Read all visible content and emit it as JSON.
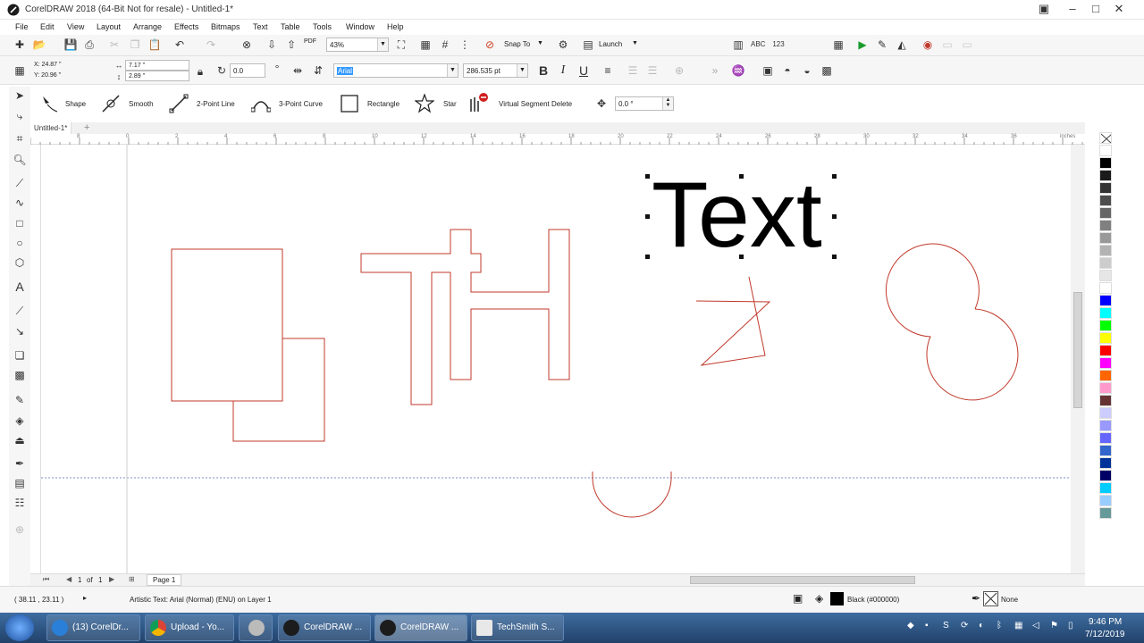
{
  "titlebar": {
    "title": "CorelDRAW 2018 (64-Bit Not for resale) - Untitled-1*"
  },
  "menu": [
    "File",
    "Edit",
    "View",
    "Layout",
    "Arrange",
    "Effects",
    "Bitmaps",
    "Text",
    "Table",
    "Tools",
    "Window",
    "Help"
  ],
  "standard_toolbar": {
    "zoom": "43%",
    "snap_to": "Snap To",
    "launch": "Launch",
    "pdf": "PDF"
  },
  "property_bar": {
    "x": "X: 24.87 \"",
    "y": "Y: 20.96 \"",
    "width": "7.17 \"",
    "height": "2.89 \"",
    "rotation": "0.0",
    "font": "Arial",
    "font_size": "286.535 pt",
    "bold": "B",
    "italic": "I",
    "underline": "U"
  },
  "shape_toolbar": {
    "items": [
      "Shape",
      "Smooth",
      "2-Point Line",
      "3-Point Curve",
      "Rectangle",
      "Star",
      "Virtual Segment Delete"
    ],
    "angle": "0.0 °"
  },
  "document": {
    "tab": "Untitled-1*",
    "canvas_text": "Text"
  },
  "ruler": {
    "ticks": [
      "8",
      "0",
      "2",
      "4",
      "6",
      "8",
      "10",
      "12",
      "14",
      "16",
      "18",
      "20",
      "22",
      "24",
      "26",
      "28",
      "30",
      "32",
      "34",
      "36"
    ],
    "units": "inches"
  },
  "page_nav": {
    "current": "1",
    "of": "of",
    "total": "1",
    "page_label": "Page 1"
  },
  "status": {
    "cursor": "( 38.11 , 23.11 )",
    "info": "Artistic Text: Arial (Normal) (ENU) on Layer 1",
    "fill": "Black (#000000)",
    "outline": "None"
  },
  "colors": {
    "accent": "#0078d7",
    "outline_red": "#c0392b",
    "taskbar": "#2b4f7f",
    "palette": [
      "#ffffff",
      "#000000",
      "#1a1a1a",
      "#333333",
      "#4d4d4d",
      "#666666",
      "#808080",
      "#999999",
      "#b3b3b3",
      "#cccccc",
      "#e6e6e6",
      "#ffffff",
      "#0000ff",
      "#00ffff",
      "#00ff00",
      "#ffff00",
      "#ff0000",
      "#ff00ff",
      "#ff6600",
      "#ff99cc",
      "#663333",
      "#ccccff",
      "#9999ff",
      "#6666ff",
      "#3366cc",
      "#003399",
      "#000066",
      "#00ccff",
      "#99ccff",
      "#669999"
    ]
  },
  "taskbar": {
    "items": [
      "(13) CorelDr...",
      "Upload - Yo...",
      "",
      "CorelDRAW ...",
      "CorelDRAW ...",
      "TechSmith S..."
    ],
    "time": "9:46 PM",
    "date": "7/12/2019"
  }
}
